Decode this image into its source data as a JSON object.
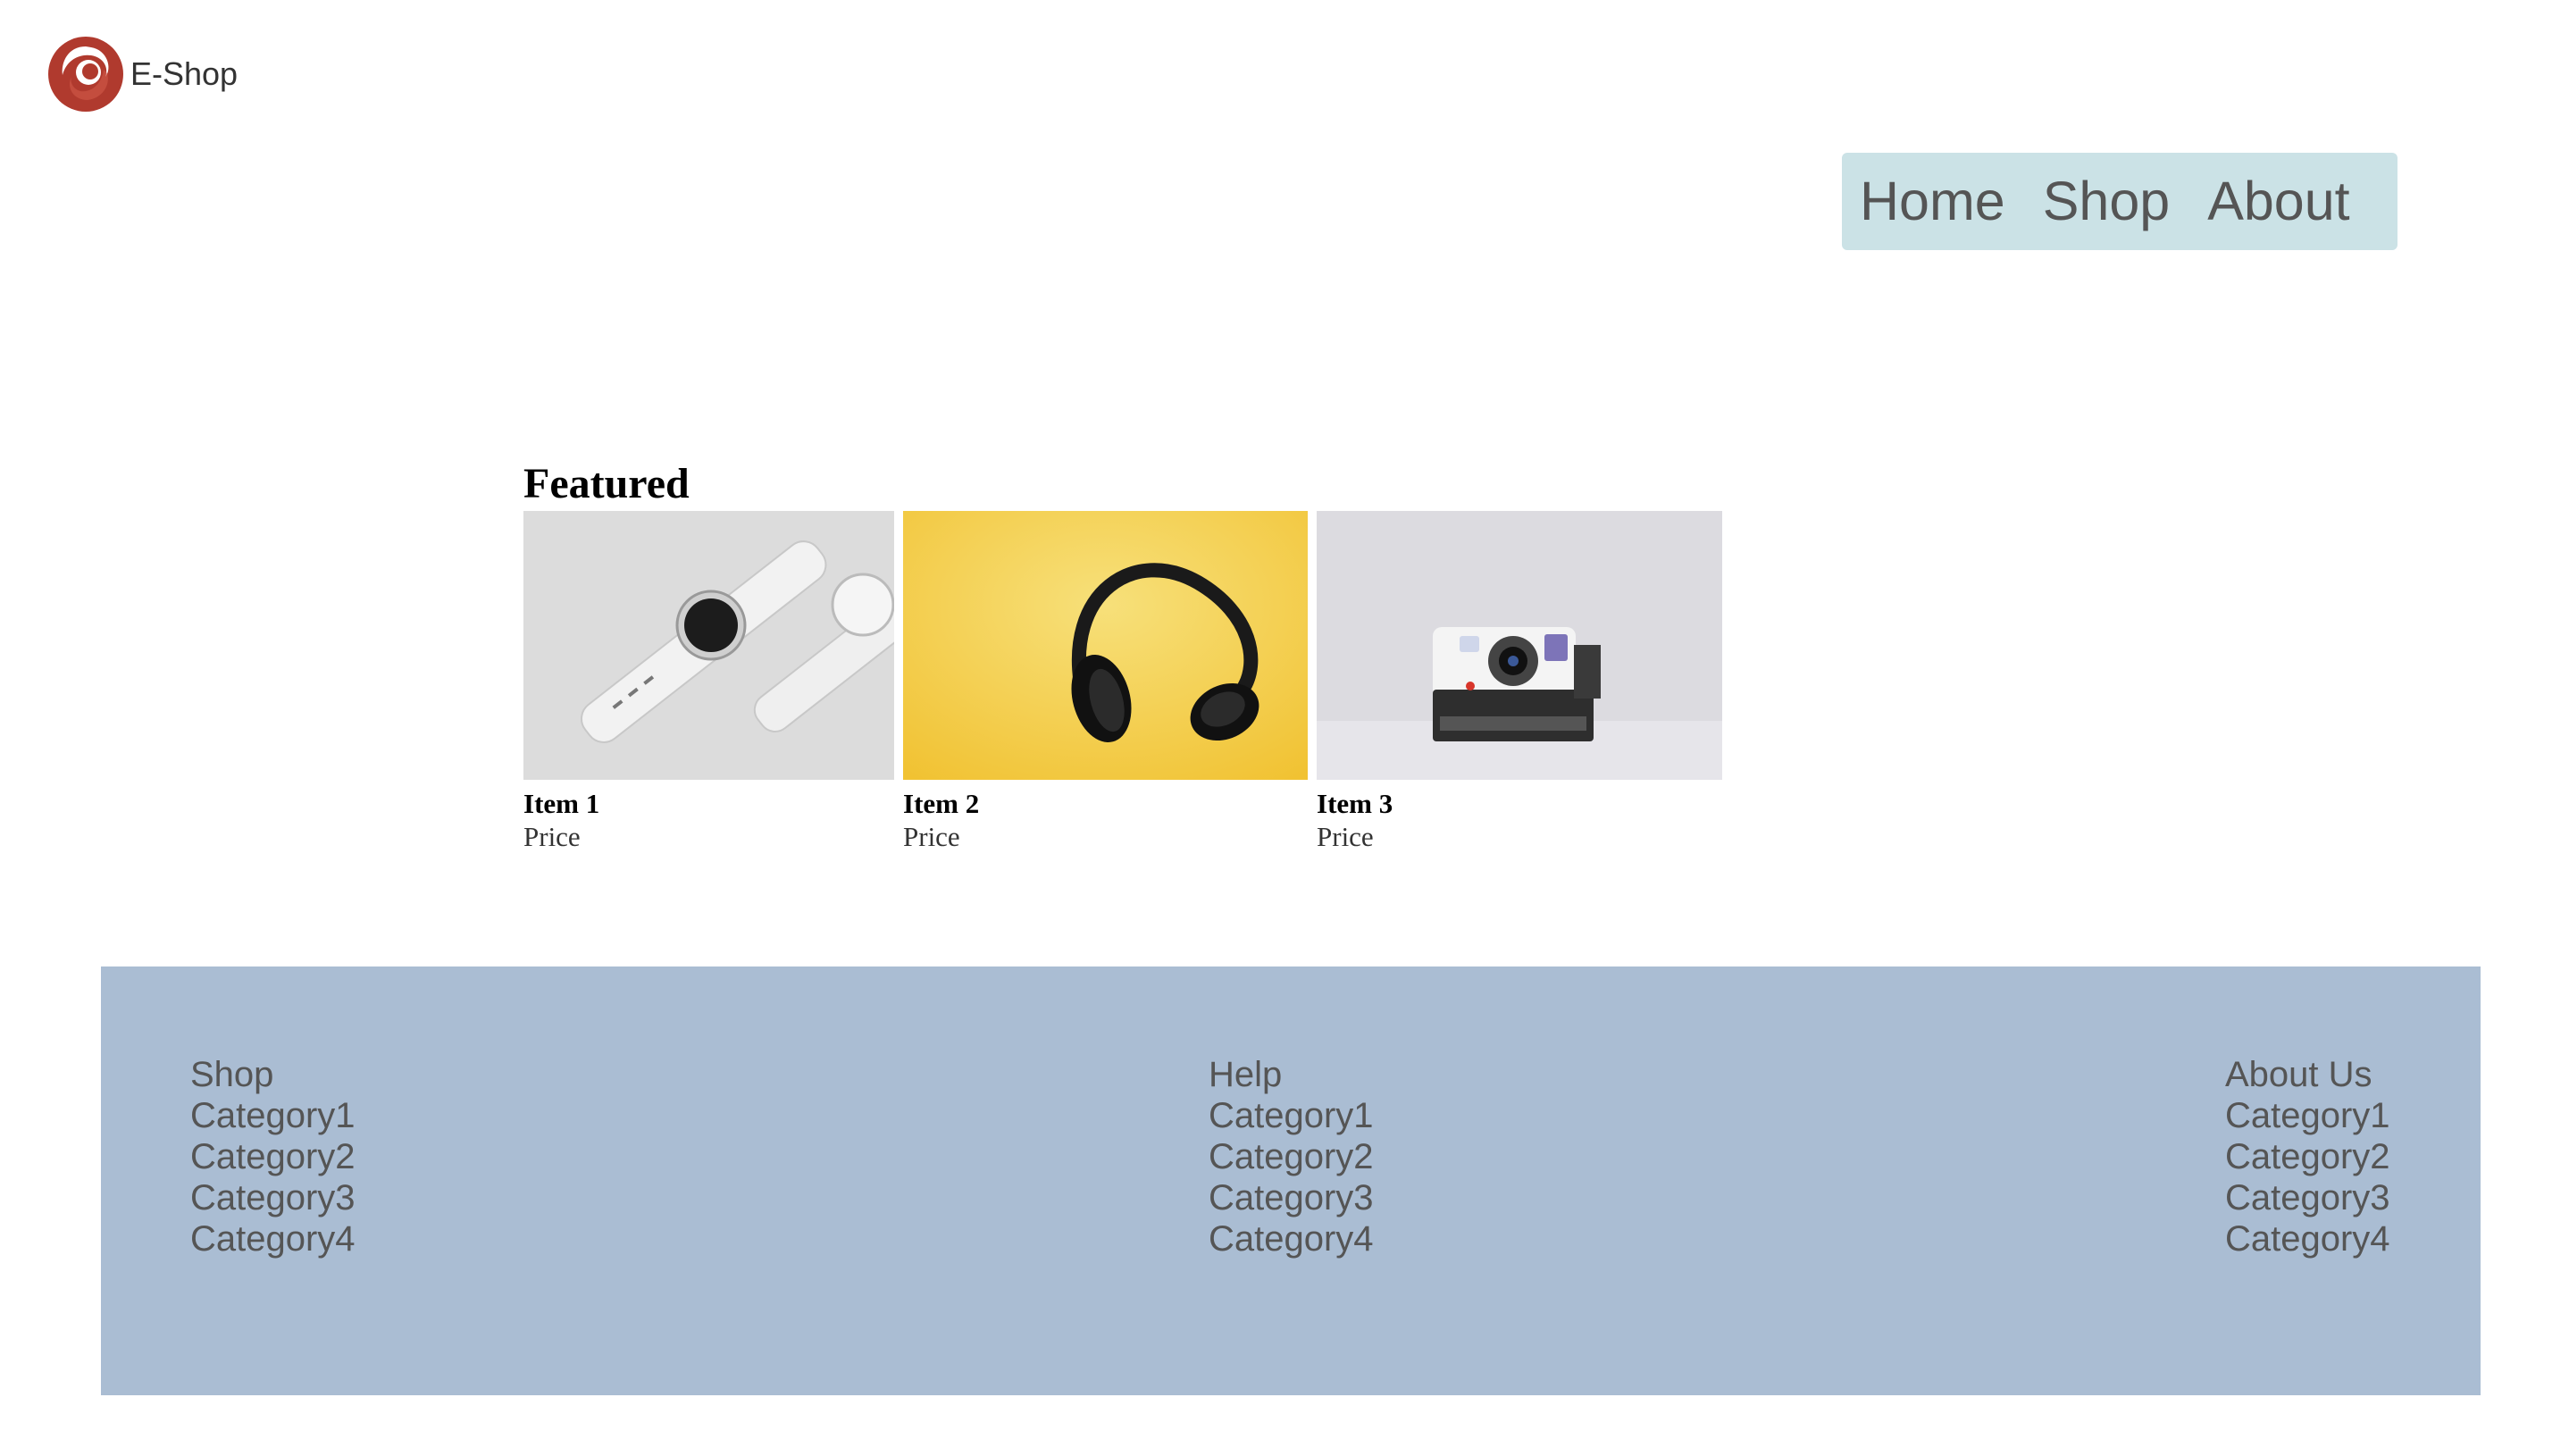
{
  "brand": {
    "name": "E-Shop",
    "logo_icon": "swirl-logo-icon",
    "color": "#b03a2e"
  },
  "nav": {
    "items": [
      "Home",
      "Shop",
      "About"
    ],
    "background": "#cbe2e6"
  },
  "featured": {
    "title": "Featured",
    "items": [
      {
        "name": "Item 1",
        "price": "Price",
        "image": "smartwatch-image"
      },
      {
        "name": "Item 2",
        "price": "Price",
        "image": "headphones-image"
      },
      {
        "name": "Item 3",
        "price": "Price",
        "image": "instant-camera-image"
      }
    ]
  },
  "footer": {
    "background": "#aabdd3",
    "columns": [
      {
        "heading": "Shop",
        "links": [
          "Category1",
          "Category2",
          "Category3",
          "Category4"
        ]
      },
      {
        "heading": "Help",
        "links": [
          "Category1",
          "Category2",
          "Category3",
          "Category4"
        ]
      },
      {
        "heading": "About Us",
        "links": [
          "Category1",
          "Category2",
          "Category3",
          "Category4"
        ]
      }
    ]
  }
}
